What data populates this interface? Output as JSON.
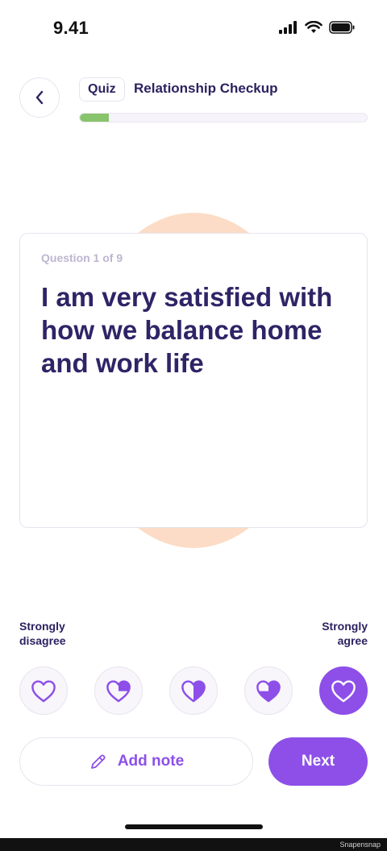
{
  "status_bar": {
    "time": "9.41"
  },
  "header": {
    "tag": "Quiz",
    "title": "Relationship Checkup",
    "progress_fraction": 0.1
  },
  "question": {
    "counter": "Question 1 of 9",
    "text": "I am very satisfied with how we balance home and work life"
  },
  "scale": {
    "left_line1": "Strongly",
    "left_line2": "disagree",
    "right_line1": "Strongly",
    "right_line2": "agree",
    "options": [
      {
        "icon": "heart-empty-icon",
        "selected": false
      },
      {
        "icon": "heart-quarter-icon",
        "selected": false
      },
      {
        "icon": "heart-half-icon",
        "selected": false
      },
      {
        "icon": "heart-three-quarter-icon",
        "selected": false
      },
      {
        "icon": "heart-full-icon",
        "selected": true
      }
    ]
  },
  "actions": {
    "add_note_label": "Add note",
    "next_label": "Next"
  },
  "watermark": "Snapensnap",
  "colors": {
    "accent": "#8d4fe8",
    "text_dark": "#2b2260",
    "progress": "#88c46b",
    "blob": "#fcdcc6"
  }
}
